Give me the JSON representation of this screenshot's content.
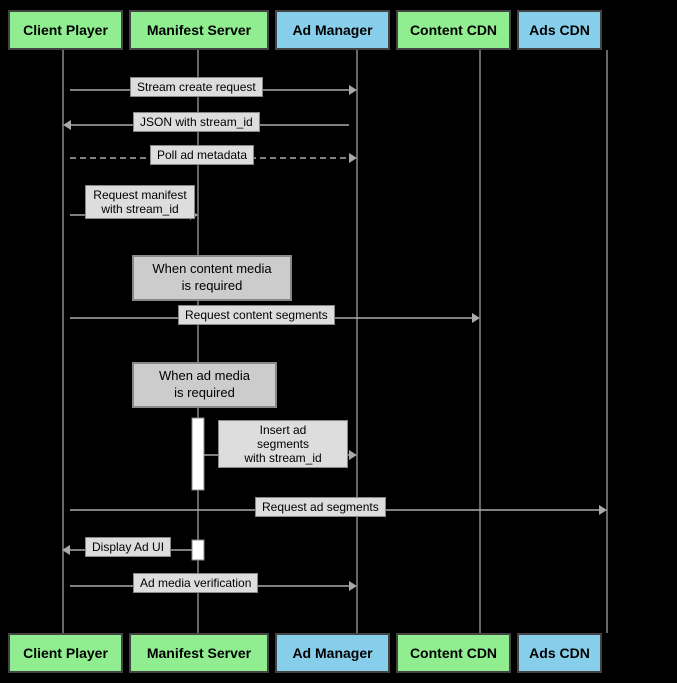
{
  "actors": {
    "client": "Client Player",
    "manifest": "Manifest Server",
    "admanager": "Ad Manager",
    "contentcdn": "Content CDN",
    "adscdn": "Ads CDN"
  },
  "messages": [
    {
      "id": "msg1",
      "label": "Stream create request",
      "direction": "right",
      "from": "client",
      "to": "admanager"
    },
    {
      "id": "msg2",
      "label": "JSON with stream_id",
      "direction": "left",
      "from": "admanager",
      "to": "client"
    },
    {
      "id": "msg3",
      "label": "Poll ad metadata",
      "direction": "right",
      "dashed": true,
      "from": "client",
      "to": "admanager"
    },
    {
      "id": "msg4",
      "label": "Request manifest\nwith stream_id",
      "direction": "right",
      "from": "client",
      "to": "manifest"
    },
    {
      "id": "msg5",
      "label": "Request content segments",
      "direction": "right",
      "from": "client",
      "to": "contentcdn"
    },
    {
      "id": "msg6",
      "label": "Insert ad\nsegments\nwith stream_id",
      "direction": "right",
      "from": "manifest",
      "to": "admanager",
      "activation": true
    },
    {
      "id": "msg7",
      "label": "Request ad segments",
      "direction": "right",
      "from": "client",
      "to": "adscdn"
    },
    {
      "id": "msg8",
      "label": "Display Ad UI",
      "direction": "left",
      "from": "manifest",
      "to": "client"
    },
    {
      "id": "msg9",
      "label": "Ad media verification",
      "direction": "right",
      "from": "client",
      "to": "admanager"
    }
  ],
  "notes": [
    {
      "id": "note1",
      "text": "When content media\nis required"
    },
    {
      "id": "note2",
      "text": "When ad media\nis required"
    }
  ]
}
